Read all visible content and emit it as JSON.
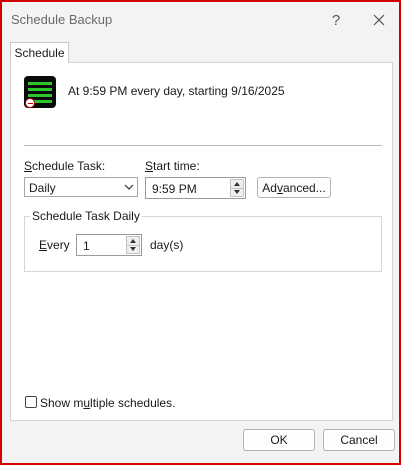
{
  "window": {
    "title": "Schedule Backup",
    "help_symbol": "?"
  },
  "tab": {
    "label": "Schedule"
  },
  "summary": {
    "text": "At 9:59 PM every day, starting 9/16/2025"
  },
  "schedule_task": {
    "label_prefix": "",
    "label_ul": "S",
    "label_rest": "chedule Task:",
    "value": "Daily"
  },
  "start_time": {
    "label_ul": "S",
    "label_rest": "tart time:",
    "value": "9:59 PM"
  },
  "advanced_button": {
    "pre": "Ad",
    "ul": "v",
    "post": "anced..."
  },
  "daily_group": {
    "title": "Schedule Task Daily",
    "every_ul": "E",
    "every_rest": "very",
    "days_value": "1",
    "days_unit": "day(s)"
  },
  "multiple": {
    "pre": "Show m",
    "ul": "u",
    "post": "ltiple schedules."
  },
  "buttons": {
    "ok": "OK",
    "cancel": "Cancel"
  },
  "icons": {
    "task": "scheduled-task-icon",
    "close": "close-icon",
    "help": "help-icon",
    "dropdown": "chevron-down-icon",
    "spin_up": "spin-up-icon",
    "spin_down": "spin-down-icon"
  },
  "colors": {
    "window_border": "#d40000",
    "icon_green": "#2ec42e"
  }
}
